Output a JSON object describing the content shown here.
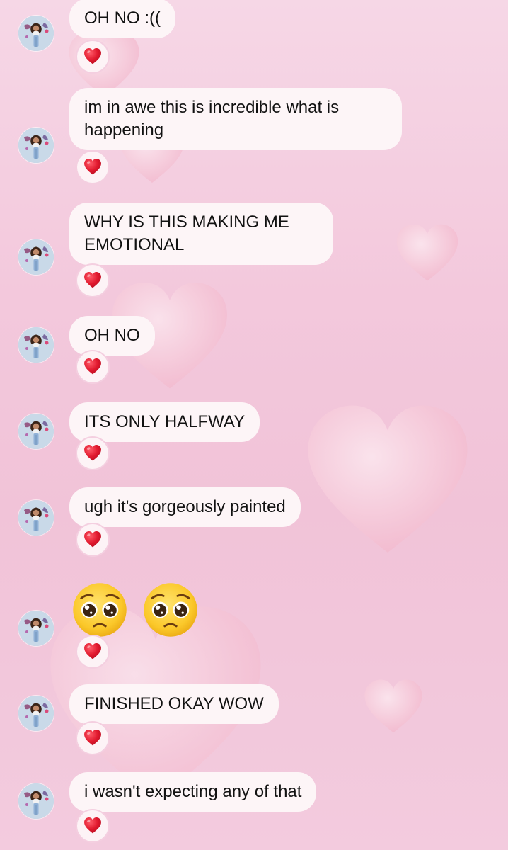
{
  "chat": {
    "messages": [
      {
        "text": "OH NO :((",
        "reaction": "heart-icon"
      },
      {
        "text": "im in awe this is incredible what is happening",
        "reaction": "heart-icon"
      },
      {
        "text": "WHY IS THIS MAKING ME EMOTIONAL",
        "reaction": "heart-icon"
      },
      {
        "text": "OH NO",
        "reaction": "heart-icon"
      },
      {
        "text": "ITS ONLY HALFWAY",
        "reaction": "heart-icon"
      },
      {
        "text": "ugh it's gorgeously painted",
        "reaction": "heart-icon"
      },
      {
        "emoji": [
          "pleading-face-icon",
          "pleading-face-icon"
        ],
        "reaction": "heart-icon"
      },
      {
        "text": "FINISHED OKAY WOW",
        "reaction": "heart-icon"
      },
      {
        "text": "i wasn't expecting any of that",
        "reaction": "heart-icon"
      }
    ]
  },
  "colors": {
    "bubble": "#fdf5f7",
    "reaction_heart": "#e0182d",
    "background_pink": "#f3c8dc"
  }
}
